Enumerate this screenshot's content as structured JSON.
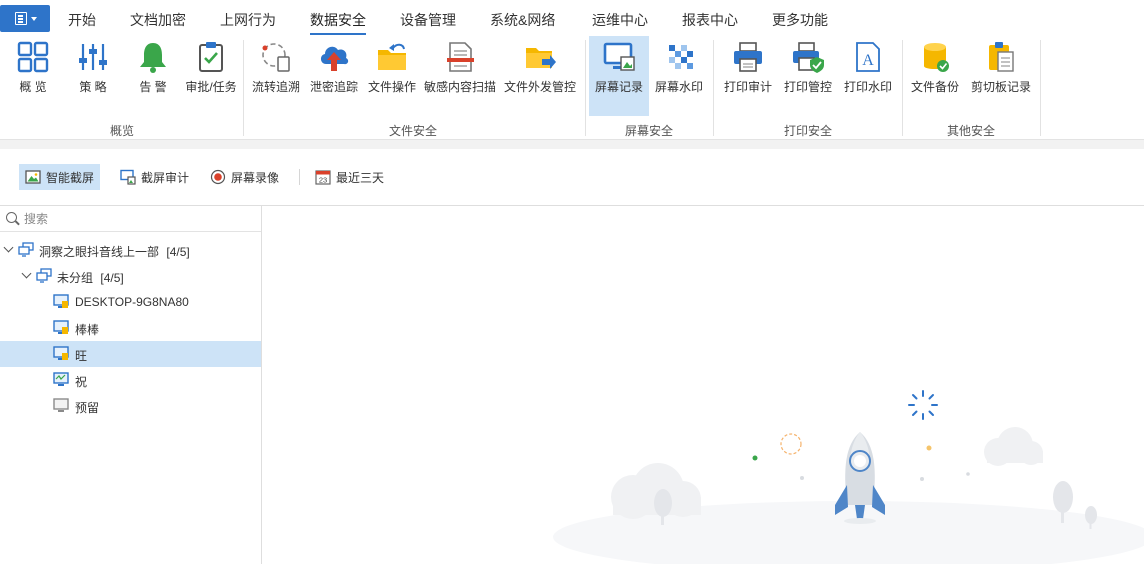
{
  "menu": {
    "tabs": [
      {
        "label": "开始"
      },
      {
        "label": "文档加密"
      },
      {
        "label": "上网行为"
      },
      {
        "label": "数据安全"
      },
      {
        "label": "设备管理"
      },
      {
        "label": "系统&网络"
      },
      {
        "label": "运维中心"
      },
      {
        "label": "报表中心"
      },
      {
        "label": "更多功能"
      }
    ],
    "active_tab": "数据安全"
  },
  "ribbon": {
    "groups": [
      {
        "label": "概览",
        "items": [
          {
            "label": "概 览",
            "icon": "grid-icon"
          },
          {
            "label": "策 略",
            "icon": "sliders-icon"
          },
          {
            "label": "告 警",
            "icon": "bell-icon"
          },
          {
            "label": "审批/任务",
            "icon": "clipboard-check-icon"
          }
        ]
      },
      {
        "label": "文件安全",
        "items": [
          {
            "label": "流转追溯",
            "icon": "trace-icon"
          },
          {
            "label": "泄密追踪",
            "icon": "cloud-upload-icon"
          },
          {
            "label": "文件操作",
            "icon": "folder-arrow-icon"
          },
          {
            "label": "敏感内容扫描",
            "icon": "document-scan-icon"
          },
          {
            "label": "文件外发管控",
            "icon": "folder-send-icon"
          }
        ]
      },
      {
        "label": "屏幕安全",
        "items": [
          {
            "label": "屏幕记录",
            "icon": "monitor-image-icon"
          },
          {
            "label": "屏幕水印",
            "icon": "watermark-icon"
          }
        ]
      },
      {
        "label": "打印安全",
        "items": [
          {
            "label": "打印审计",
            "icon": "printer-icon"
          },
          {
            "label": "打印管控",
            "icon": "printer-shield-icon"
          },
          {
            "label": "打印水印",
            "icon": "document-a-icon"
          }
        ]
      },
      {
        "label": "其他安全",
        "items": [
          {
            "label": "文件备份",
            "icon": "database-icon"
          },
          {
            "label": "剪切板记录",
            "icon": "clipboard-icon"
          }
        ]
      }
    ],
    "selected_item": "屏幕记录"
  },
  "toolbar": {
    "items": [
      {
        "label": "智能截屏",
        "icon": "image-icon"
      },
      {
        "label": "截屏审计",
        "icon": "screenshot-audit-icon"
      },
      {
        "label": "屏幕录像",
        "icon": "record-icon"
      },
      {
        "label": "最近三天",
        "icon": "calendar-icon",
        "calendar_day": "23"
      }
    ],
    "selected_item": "智能截屏"
  },
  "search": {
    "placeholder": "搜索"
  },
  "tree": {
    "root": {
      "label": "洞察之眼抖音线上一部",
      "count": "[4/5]"
    },
    "group": {
      "label": "未分组",
      "count": "[4/5]"
    },
    "computers": [
      {
        "label": "DESKTOP-9G8NA80",
        "online": true
      },
      {
        "label": "棒棒",
        "online": true
      },
      {
        "label": "旺",
        "online": true
      },
      {
        "label": "祝",
        "online": true
      },
      {
        "label": "预留",
        "online": false
      }
    ],
    "selected": "旺"
  },
  "colors": {
    "accent": "#2e74c9",
    "selection": "#cde3f7",
    "bell": "#3aa64a",
    "folder": "#f5b700",
    "record": "#d9412b"
  }
}
